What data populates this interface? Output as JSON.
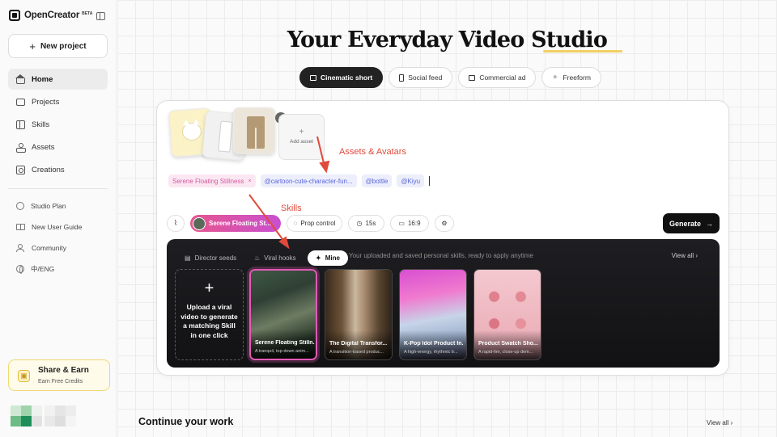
{
  "app": {
    "name": "OpenCreator",
    "badge": "BETA"
  },
  "sidebar": {
    "new_project": "New project",
    "nav": [
      {
        "label": "Home",
        "icon": "home-icon"
      },
      {
        "label": "Projects",
        "icon": "folder-icon"
      },
      {
        "label": "Skills",
        "icon": "skills-icon"
      },
      {
        "label": "Assets",
        "icon": "assets-icon"
      },
      {
        "label": "Creations",
        "icon": "creations-icon"
      }
    ],
    "secondary": [
      {
        "label": "Studio Plan",
        "icon": "plan-icon"
      },
      {
        "label": "New User Guide",
        "icon": "book-icon"
      },
      {
        "label": "Community",
        "icon": "community-icon"
      },
      {
        "label": "中/ENG",
        "icon": "globe-icon"
      }
    ],
    "share": {
      "title": "Share & Earn",
      "subtitle": "Earn Free Credits"
    }
  },
  "hero": {
    "title_part1": "Your Everyday Video",
    "title_part2": "Studio"
  },
  "mode_tabs": [
    {
      "label": "Cinematic short",
      "active": true
    },
    {
      "label": "Social feed",
      "active": false
    },
    {
      "label": "Commercial ad",
      "active": false
    },
    {
      "label": "Freeform",
      "active": false
    }
  ],
  "composer": {
    "add_asset_label": "Add asset",
    "chips": [
      {
        "text": "Serene Floating Stillness",
        "type": "skill"
      },
      {
        "text": "@cartoon-cute-character-fun...",
        "type": "asset"
      },
      {
        "text": "@bottle",
        "type": "asset"
      },
      {
        "text": "@Kiyu",
        "type": "asset"
      }
    ],
    "toolbar": {
      "skill_label": "Serene Floating St...",
      "prop_control": "Prop control",
      "duration": "15s",
      "aspect": "16:9",
      "generate": "Generate"
    }
  },
  "annotations": {
    "assets": "Assets & Avatars",
    "skills": "Skills"
  },
  "skills_panel": {
    "tabs": [
      {
        "label": "Director seeds",
        "active": false
      },
      {
        "label": "Viral hooks",
        "active": false
      },
      {
        "label": "Mine",
        "active": true
      }
    ],
    "description": "Your uploaded and saved personal skills, ready to apply anytime",
    "view_all": "View all",
    "upload_text": "Upload a viral video to generate a matching Skill in one click",
    "cards": [
      {
        "title": "Serene Floating Stilln...",
        "desc": "A tranquil, top-down anim...",
        "selected": true
      },
      {
        "title": "The Digital Transfor...",
        "desc": "A transition-based produc...",
        "selected": false
      },
      {
        "title": "K-Pop Idol Product In...",
        "desc": "A high-energy, rhythmic tr...",
        "selected": false
      },
      {
        "title": "Product Swatch Sho...",
        "desc": "A rapid-fire, close-up dem...",
        "selected": false
      }
    ]
  },
  "continue": {
    "title": "Continue your work",
    "view_all": "View all"
  },
  "colors": {
    "accent_pink": "#e45ab5",
    "annotation_red": "#e04a3c",
    "highlight_yellow": "#f2cf63"
  }
}
